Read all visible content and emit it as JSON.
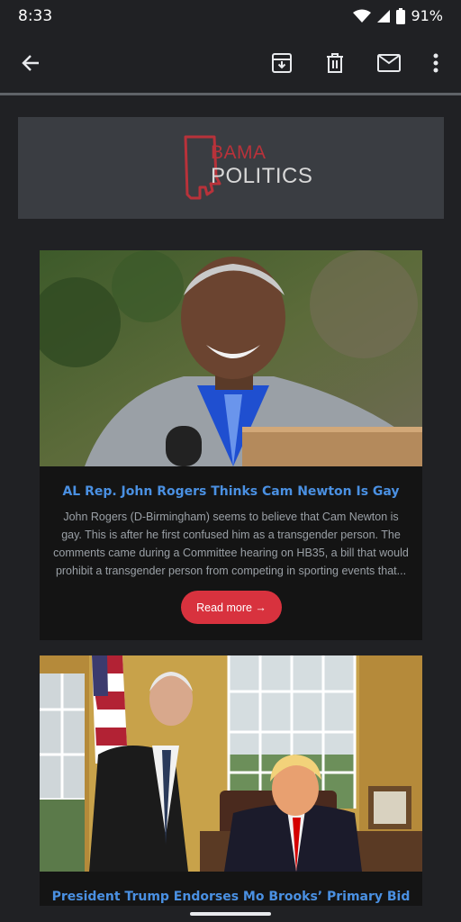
{
  "status_bar": {
    "time": "8:33",
    "battery_percent": "91%"
  },
  "toolbar": {
    "back_icon": "arrow-back-icon",
    "archive_icon": "archive-icon",
    "delete_icon": "trash-icon",
    "mark_unread_icon": "mail-icon",
    "more_icon": "more-vert-icon"
  },
  "brand": {
    "line1": "BAMA",
    "line2": "POLITICS",
    "accent": "#b8323a"
  },
  "articles": [
    {
      "title": "AL Rep. John Rogers Thinks Cam Newton Is Gay",
      "excerpt": "John Rogers (D-Birmingham) seems to believe that Cam Newton is gay. This is after he first confused him as a transgender person. The comments came during a Committee hearing on HB35, a bill that would prohibit a transgender person from competing in sporting events that...",
      "button": "Read more →"
    },
    {
      "title": "President Trump Endorses Mo Brooks’ Primary Bid"
    }
  ],
  "colors": {
    "link": "#4a90e2",
    "button": "#d8323e",
    "background": "#202124"
  }
}
